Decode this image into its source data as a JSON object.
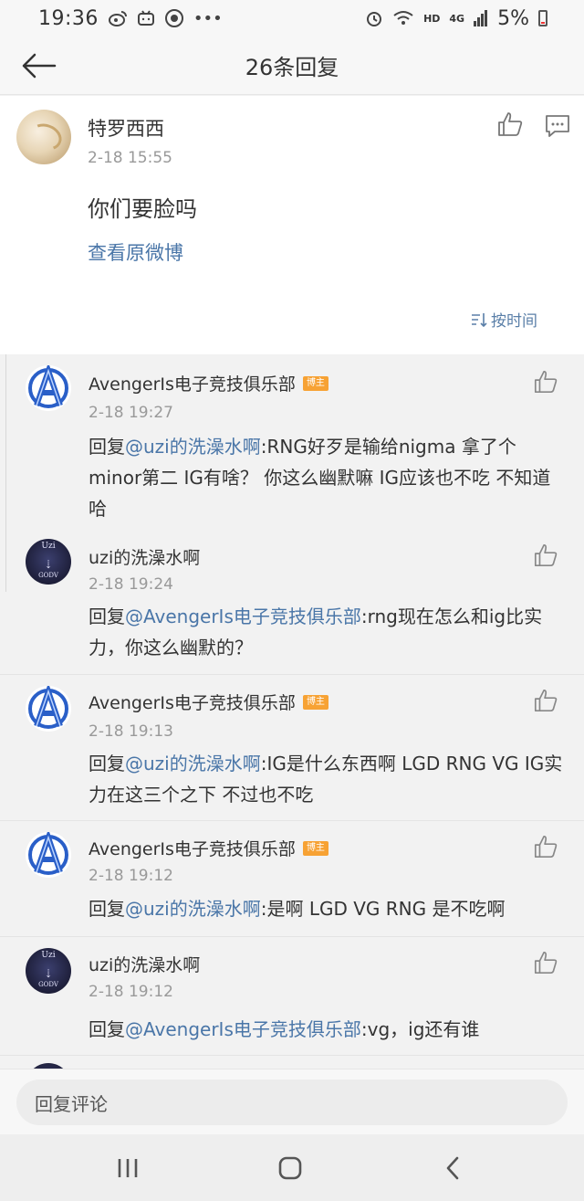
{
  "status_bar": {
    "time": "19:36",
    "network": "HD",
    "signal_label": "4G",
    "battery": "5%"
  },
  "header": {
    "title": "26条回复"
  },
  "main_post": {
    "author": "特罗西西",
    "timestamp": "2-18 15:55",
    "content": "你们要脸吗",
    "view_original": "查看原微博",
    "sort_label": "按时间"
  },
  "badge_label": "博主",
  "replies": [
    {
      "author": "AvengerIs电子竞技俱乐部",
      "is_blogger": true,
      "timestamp": "2-18 19:27",
      "prefix": "回复",
      "mention": "@uzi的洗澡水啊",
      "text": ":RNG好歹是输给nigma 拿了个minor第二 IG有啥？ 你这么幽默嘛 IG应该也不吃 不知道哈"
    },
    {
      "author": "uzi的洗澡水啊",
      "is_blogger": false,
      "timestamp": "2-18 19:24",
      "prefix": "回复",
      "mention": "@AvengerIs电子竞技俱乐部",
      "text": ":rng现在怎么和ig比实力，你这么幽默的？"
    },
    {
      "author": "AvengerIs电子竞技俱乐部",
      "is_blogger": true,
      "timestamp": "2-18 19:13",
      "prefix": "回复",
      "mention": "@uzi的洗澡水啊",
      "text": ":IG是什么东西啊 LGD RNG VG IG实力在这三个之下 不过也不吃"
    },
    {
      "author": "AvengerIs电子竞技俱乐部",
      "is_blogger": true,
      "timestamp": "2-18 19:12",
      "prefix": "回复",
      "mention": "@uzi的洗澡水啊",
      "text": ":是啊 LGD VG RNG 是不吃啊"
    },
    {
      "author": "uzi的洗澡水啊",
      "is_blogger": false,
      "timestamp": "2-18 19:12",
      "prefix": "回复",
      "mention": "@AvengerIs电子竞技俱乐部",
      "text": ":vg，ig还有谁"
    }
  ],
  "uzi_avatar_text": {
    "top": "Uzi",
    "bottom": "GODV"
  },
  "input": {
    "placeholder": "回复评论"
  },
  "colors": {
    "link": "#4a76a8",
    "badge": "#f7a234",
    "avengers_logo": "#3a6fd8"
  },
  "icons": [
    "back-arrow-icon",
    "like-icon",
    "comment-icon",
    "sort-icon",
    "recents-icon",
    "home-icon",
    "back-nav-icon"
  ]
}
